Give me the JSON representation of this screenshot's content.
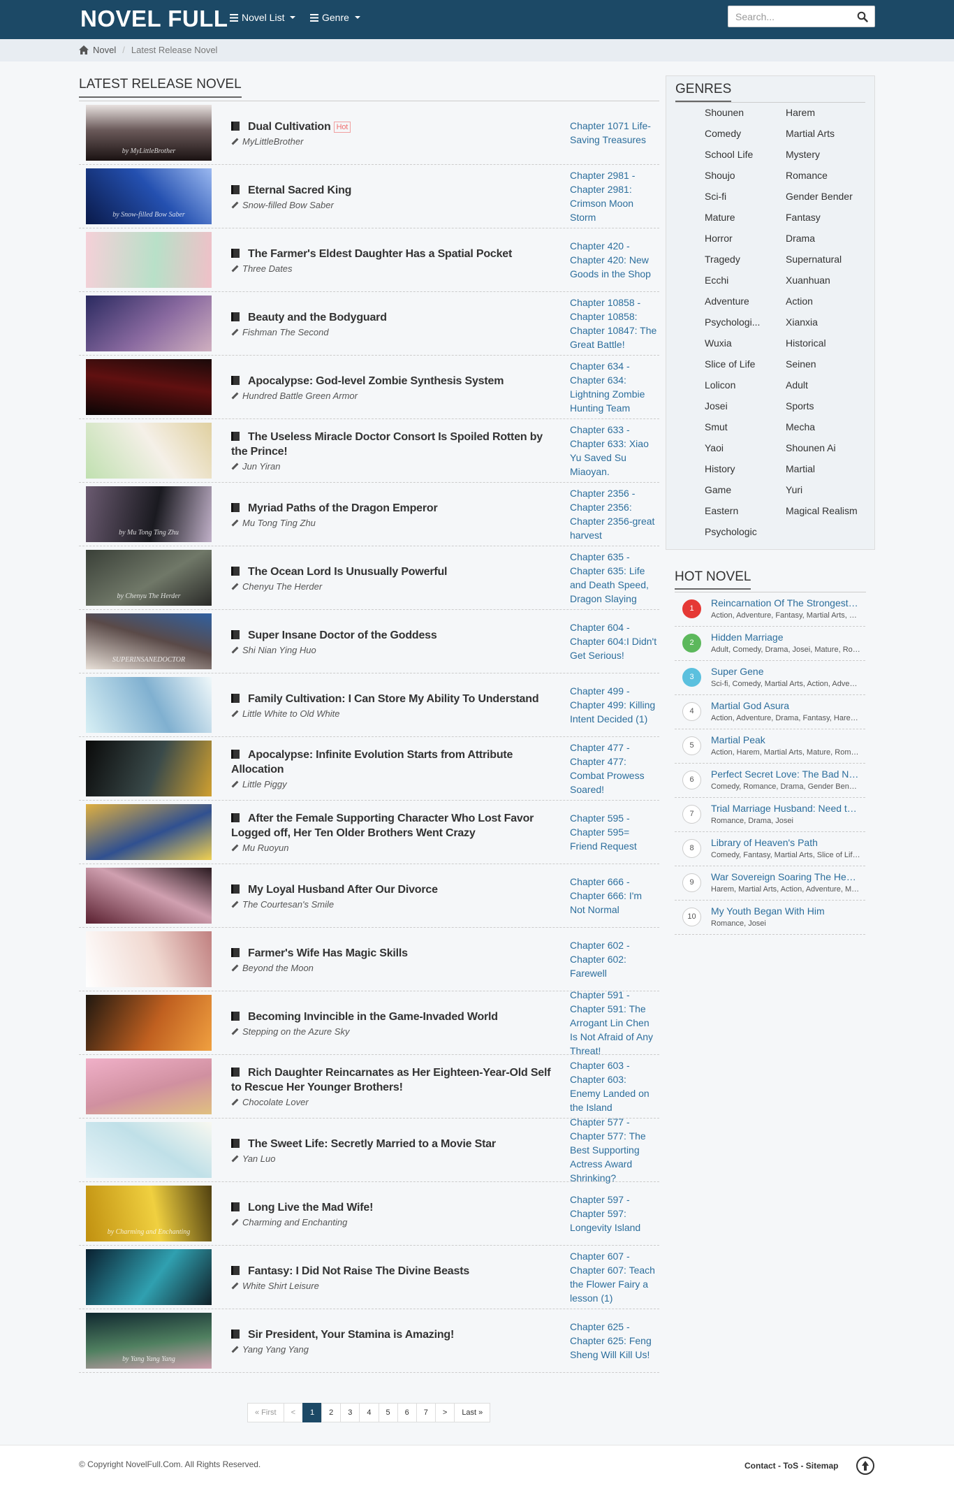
{
  "header": {
    "logo": "NOVEL FULL",
    "nav_novel_list": "Novel List",
    "nav_genre": "Genre",
    "search_placeholder": "Search..."
  },
  "breadcrumb": {
    "home": "Novel",
    "current": "Latest Release Novel"
  },
  "main": {
    "title": "LATEST RELEASE NOVEL",
    "hot_label": "Hot",
    "novels": [
      {
        "title": "Dual Cultivation",
        "author": "MyLittleBrother",
        "chapter": "Chapter 1071 Life-Saving Treasures",
        "hot": true,
        "cover_text": "by MyLittleBrother",
        "colors": [
          "#1a1212",
          "#6b5a5a",
          "#e8e2e0"
        ]
      },
      {
        "title": "Eternal Sacred King",
        "author": "Snow-filled Bow Saber",
        "chapter": "Chapter 2981 - Chapter 2981: Crimson Moon Storm",
        "hot": false,
        "cover_text": "by Snow-filled Bow Saber",
        "colors": [
          "#0a1a4a",
          "#2450b0",
          "#9ab8f0"
        ]
      },
      {
        "title": "The Farmer's Eldest Daughter Has a Spatial Pocket",
        "author": "Three Dates",
        "chapter": "Chapter 420 - Chapter 420: New Goods in the Shop",
        "hot": false,
        "cover_text": "",
        "colors": [
          "#f5d0d8",
          "#b8e0c8",
          "#f0c0c8"
        ]
      },
      {
        "title": "Beauty and the Bodyguard",
        "author": "Fishman The Second",
        "chapter": "Chapter 10858 - Chapter 10858: Chapter 10847: The Great Battle!",
        "hot": false,
        "cover_text": "",
        "colors": [
          "#2a2a60",
          "#8a6aa0",
          "#d0b0c0"
        ]
      },
      {
        "title": "Apocalypse: God-level Zombie Synthesis System",
        "author": "Hundred Battle Green Armor",
        "chapter": "Chapter 634 - Chapter 634: Lightning Zombie Hunting Team",
        "hot": false,
        "cover_text": "",
        "colors": [
          "#0a0505",
          "#601010",
          "#1a0a0a"
        ]
      },
      {
        "title": "The Useless Miracle Doctor Consort Is Spoiled Rotten by the Prince!",
        "author": "Jun Yiran",
        "chapter": "Chapter 633 - Chapter 633: Xiao Yu Saved Su Miaoyan.",
        "hot": false,
        "cover_text": "",
        "colors": [
          "#c0e0b0",
          "#f5f0e8",
          "#e0d0a0"
        ]
      },
      {
        "title": "Myriad Paths of the Dragon Emperor",
        "author": "Mu Tong Ting Zhu",
        "chapter": "Chapter 2356 - Chapter 2356: Chapter 2356-great harvest",
        "hot": false,
        "cover_text": "by Mu Tong Ting Zhu",
        "colors": [
          "#6a5a70",
          "#1a1a20",
          "#c0b0c8"
        ]
      },
      {
        "title": "The Ocean Lord Is Unusually Powerful",
        "author": "Chenyu The Herder",
        "chapter": "Chapter 635 - Chapter 635: Life and Death Speed, Dragon Slaying",
        "hot": false,
        "cover_text": "by Chenyu The Herder",
        "colors": [
          "#3a4038",
          "#707868",
          "#2a2a28"
        ]
      },
      {
        "title": "Super Insane Doctor of the Goddess",
        "author": "Shi Nian Ying Huo",
        "chapter": "Chapter 604 - Chapter 604:I Didn't Get Serious!",
        "hot": false,
        "cover_text": "SUPERINSANEDOCTOR",
        "colors": [
          "#e8e0d8",
          "#5a4a48",
          "#3060a0"
        ]
      },
      {
        "title": "Family Cultivation: I Can Store My Ability To Understand",
        "author": "Little White to Old White",
        "chapter": "Chapter 499 - Chapter 499: Killing Intent Decided (1)",
        "hot": false,
        "cover_text": "",
        "colors": [
          "#d8f0f5",
          "#80b0d0",
          "#f0f8fa"
        ]
      },
      {
        "title": "Apocalypse: Infinite Evolution Starts from Attribute Allocation",
        "author": "Little Piggy",
        "chapter": "Chapter 477 - Chapter 477: Combat Prowess Soared!",
        "hot": false,
        "cover_text": "",
        "colors": [
          "#0a0a0a",
          "#3a4a4a",
          "#d0a030"
        ]
      },
      {
        "title": "After the Female Supporting Character Who Lost Favor Logged off, Her Ten Older Brothers Went Crazy",
        "author": "Mu Ruoyun",
        "chapter": "Chapter 595 - Chapter 595= Friend Request",
        "hot": false,
        "cover_text": "",
        "colors": [
          "#e0b040",
          "#305090",
          "#f0d050"
        ]
      },
      {
        "title": "My Loyal Husband After Our Divorce",
        "author": "The Courtesan's Smile",
        "chapter": "Chapter 666 - Chapter 666: I'm Not Normal",
        "hot": false,
        "cover_text": "",
        "colors": [
          "#5a2030",
          "#d0a0b0",
          "#2a1a20"
        ]
      },
      {
        "title": "Farmer's Wife Has Magic Skills",
        "author": "Beyond the Moon",
        "chapter": "Chapter 602 - Chapter 602: Farewell",
        "hot": false,
        "cover_text": "",
        "colors": [
          "#ffffff",
          "#f0d8d0",
          "#c08080"
        ]
      },
      {
        "title": "Becoming Invincible in the Game-Invaded World",
        "author": "Stepping on the Azure Sky",
        "chapter": "Chapter 591 - Chapter 591: The Arrogant Lin Chen Is Not Afraid of Any Threat!",
        "hot": false,
        "cover_text": "",
        "colors": [
          "#201810",
          "#c06020",
          "#f0a040"
        ]
      },
      {
        "title": "Rich Daughter Reincarnates as Her Eighteen-Year-Old Self to Rescue Her Younger Brothers!",
        "author": "Chocolate Lover",
        "chapter": "Chapter 603 - Chapter 603: Enemy Landed on the Island",
        "hot": false,
        "cover_text": "",
        "colors": [
          "#f0b0c8",
          "#d090a0",
          "#e0c080"
        ]
      },
      {
        "title": "The Sweet Life: Secretly Married to a Movie Star",
        "author": "Yan Luo",
        "chapter": "Chapter 577 - Chapter 577: The Best Supporting Actress Award Shrinking?",
        "hot": false,
        "cover_text": "",
        "colors": [
          "#e8f4f8",
          "#c0e0e8",
          "#f8f8f0"
        ]
      },
      {
        "title": "Long Live the Mad Wife!",
        "author": "Charming and Enchanting",
        "chapter": "Chapter 597 - Chapter 597: Longevity Island",
        "hot": false,
        "cover_text": "by Charming and Enchanting",
        "colors": [
          "#c09010",
          "#f0d040",
          "#504010"
        ]
      },
      {
        "title": "Fantasy: I Did Not Raise The Divine Beasts",
        "author": "White Shirt Leisure",
        "chapter": "Chapter 607 - Chapter 607: Teach the Flower Fairy a lesson (1)",
        "hot": false,
        "cover_text": "",
        "colors": [
          "#0a2030",
          "#30a0b0",
          "#102028"
        ]
      },
      {
        "title": "Sir President, Your Stamina is Amazing!",
        "author": "Yang Yang Yang",
        "chapter": "Chapter 625 - Chapter 625: Feng Sheng Will Kill Us!",
        "hot": false,
        "cover_text": "by Yang Yang Yang",
        "colors": [
          "#102830",
          "#508060",
          "#d0a0b0"
        ]
      }
    ]
  },
  "pagination": {
    "first": "« First",
    "prev": "<",
    "pages": [
      "1",
      "2",
      "3",
      "4",
      "5",
      "6",
      "7"
    ],
    "current": "1",
    "next": ">",
    "last": "Last »"
  },
  "genres": {
    "title": "GENRES",
    "left": [
      "Shounen",
      "Comedy",
      "School Life",
      "Shoujo",
      "Sci-fi",
      "Mature",
      "Horror",
      "Tragedy",
      "Ecchi",
      "Adventure",
      "Psychologi...",
      "Wuxia",
      "Slice of Life",
      "Lolicon",
      "Josei",
      "Smut",
      "Yaoi",
      "History",
      "Game",
      "Eastern",
      "Psychologic"
    ],
    "right": [
      "Harem",
      "Martial Arts",
      "Mystery",
      "Romance",
      "Gender Bender",
      "Fantasy",
      "Drama",
      "Supernatural",
      "Xuanhuan",
      "Action",
      "Xianxia",
      "Historical",
      "Seinen",
      "Adult",
      "Sports",
      "Mecha",
      "Shounen Ai",
      "Martial",
      "Yuri",
      "Magical Realism"
    ]
  },
  "hot_novels": {
    "title": "HOT NOVEL",
    "items": [
      {
        "rank": "1",
        "title": "Reincarnation Of The Strongest Sword God",
        "genres": "Action, Adventure, Fantasy, Martial Arts, Xuanhuan"
      },
      {
        "rank": "2",
        "title": "Hidden Marriage",
        "genres": "Adult, Comedy, Drama, Josei, Mature, Romance"
      },
      {
        "rank": "3",
        "title": "Super Gene",
        "genres": "Sci-fi, Comedy, Martial Arts, Action, Adventure"
      },
      {
        "rank": "4",
        "title": "Martial God Asura",
        "genres": "Action, Adventure, Drama, Fantasy, Harem, Martial Arts"
      },
      {
        "rank": "5",
        "title": "Martial Peak",
        "genres": "Action, Harem, Martial Arts, Mature, Romance"
      },
      {
        "rank": "6",
        "title": "Perfect Secret Love: The Bad New Wife is a Little Sweet",
        "genres": "Comedy, Romance, Drama, Gender Bender, Josei"
      },
      {
        "rank": "7",
        "title": "Trial Marriage Husband: Need to Work Hard",
        "genres": "Romance, Drama, Josei"
      },
      {
        "rank": "8",
        "title": "Library of Heaven's Path",
        "genres": "Comedy, Fantasy, Martial Arts, Slice of Life, Xuanhuan"
      },
      {
        "rank": "9",
        "title": "War Sovereign Soaring The Heavens",
        "genres": "Harem, Martial Arts, Action, Adventure, Martial"
      },
      {
        "rank": "10",
        "title": "My Youth Began With Him",
        "genres": "Romance, Josei"
      }
    ]
  },
  "footer": {
    "copyright": "© Copyright NovelFull.Com. All Rights Reserved.",
    "contact": "Contact",
    "tos": "ToS",
    "sitemap": "Sitemap",
    "sep": " - "
  }
}
